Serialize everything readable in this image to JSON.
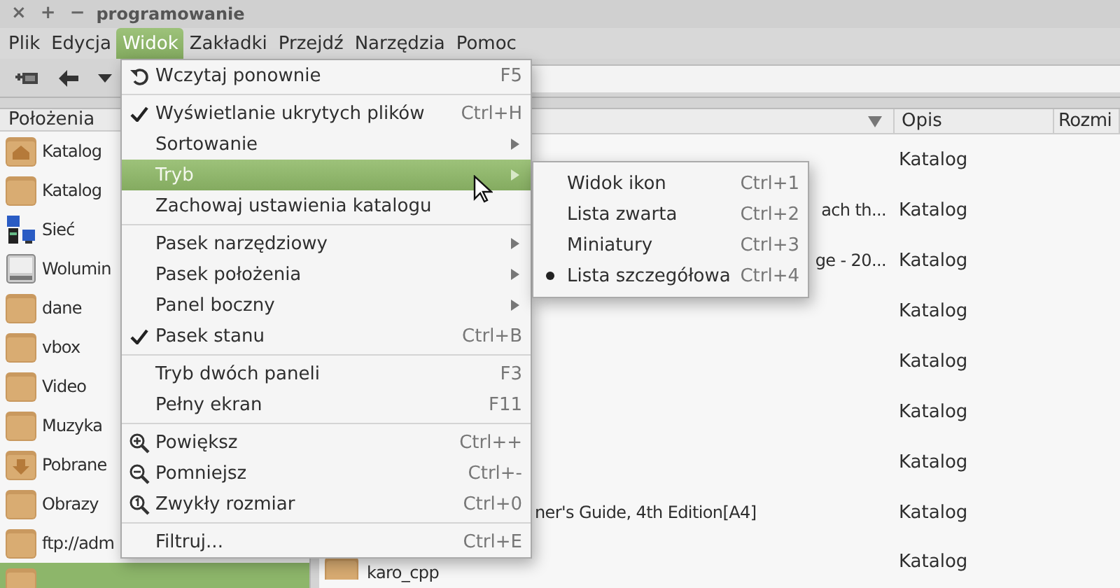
{
  "window": {
    "title": "programowanie",
    "controls": [
      "×",
      "+",
      "−"
    ]
  },
  "menubar": [
    {
      "label": "Plik",
      "selected": false
    },
    {
      "label": "Edycja",
      "selected": false
    },
    {
      "label": "Widok",
      "selected": true
    },
    {
      "label": "Zakładki",
      "selected": false
    },
    {
      "label": "Przejdź",
      "selected": false
    },
    {
      "label": "Narzędzia",
      "selected": false
    },
    {
      "label": "Pomoc",
      "selected": false
    }
  ],
  "sidebar": {
    "title": "Położenia",
    "items": [
      {
        "kind": "home",
        "label": "Katalog",
        "selected": false
      },
      {
        "kind": "folder",
        "label": "Katalog",
        "selected": false
      },
      {
        "kind": "network",
        "label": "Sieć",
        "selected": false
      },
      {
        "kind": "drive",
        "label": "Wolumin",
        "selected": false
      },
      {
        "kind": "folder",
        "label": "dane",
        "selected": false
      },
      {
        "kind": "folder",
        "label": "vbox",
        "selected": false
      },
      {
        "kind": "folder",
        "label": "Video",
        "selected": false
      },
      {
        "kind": "folder",
        "label": "Muzyka",
        "selected": false
      },
      {
        "kind": "download",
        "label": "Pobrane",
        "selected": false
      },
      {
        "kind": "folder",
        "label": "Obrazy",
        "selected": false
      },
      {
        "kind": "folder",
        "label": "ftp://adm",
        "selected": false
      },
      {
        "kind": "folder",
        "selected": true
      }
    ]
  },
  "file_list": {
    "columns": [
      {
        "sorted": true
      },
      {
        "label": "Opis",
        "sorted": false
      },
      {
        "label": "Rozmi",
        "sorted": false
      }
    ],
    "rows": [
      {
        "kind": "covered",
        "description": "Katalog"
      },
      {
        "kind": "covered_sub",
        "name": "ach th...",
        "description": "Katalog"
      },
      {
        "kind": "covered_sub",
        "name": "ge - 20...",
        "description": "Katalog"
      },
      {
        "kind": "covered",
        "description": "Katalog"
      },
      {
        "kind": "covered",
        "description": "Katalog"
      },
      {
        "kind": "covered",
        "description": "Katalog"
      },
      {
        "kind": "covered",
        "description": "Katalog"
      },
      {
        "kind": "covered",
        "name": "ner's Guide, 4th Edition[A4]",
        "description": "Katalog"
      },
      {
        "kind": "visible",
        "name": "karo_cpp",
        "description": "Katalog"
      }
    ]
  },
  "view_menu": [
    {
      "kind": "reload",
      "label": "Wczytaj ponownie",
      "shortcut": "F5",
      "selected": false
    },
    {
      "kind": "separator"
    },
    {
      "kind": "check",
      "label": "Wyświetlanie ukrytych plików",
      "shortcut": "Ctrl+H",
      "checked": true,
      "selected": false
    },
    {
      "kind": "submenu",
      "label": "Sortowanie",
      "selected": false
    },
    {
      "kind": "submenu",
      "label": "Tryb",
      "selected": true
    },
    {
      "kind": "plain",
      "label": "Zachowaj ustawienia katalogu",
      "selected": false
    },
    {
      "kind": "separator"
    },
    {
      "kind": "submenu",
      "label": "Pasek narzędziowy",
      "selected": false
    },
    {
      "kind": "submenu",
      "label": "Pasek położenia",
      "selected": false
    },
    {
      "kind": "submenu",
      "label": "Panel boczny",
      "selected": false
    },
    {
      "kind": "check",
      "label": "Pasek stanu",
      "shortcut": "Ctrl+B",
      "checked": true,
      "selected": false
    },
    {
      "kind": "separator"
    },
    {
      "kind": "plain",
      "label": "Tryb dwóch paneli",
      "shortcut": "F3",
      "selected": false
    },
    {
      "kind": "plain",
      "label": "Pełny ekran",
      "shortcut": "F11",
      "selected": false
    },
    {
      "kind": "separator"
    },
    {
      "kind": "zoom_in",
      "label": "Powiększ",
      "shortcut": "Ctrl++",
      "selected": false
    },
    {
      "kind": "zoom_out",
      "label": "Pomniejsz",
      "shortcut": "Ctrl+-",
      "selected": false
    },
    {
      "kind": "zoom_reset",
      "label": "Zwykły rozmiar",
      "shortcut": "Ctrl+0",
      "selected": false
    },
    {
      "kind": "separator"
    },
    {
      "kind": "plain",
      "label": "Filtruj...",
      "shortcut": "Ctrl+E",
      "selected": false
    }
  ],
  "mode_submenu": [
    {
      "label": "Widok ikon",
      "shortcut": "Ctrl+1",
      "selected": false
    },
    {
      "label": "Lista zwarta",
      "shortcut": "Ctrl+2",
      "selected": false
    },
    {
      "label": "Miniatury",
      "shortcut": "Ctrl+3",
      "selected": false
    },
    {
      "label": "Lista szczegółowa",
      "shortcut": "Ctrl+4",
      "selected": true
    }
  ]
}
